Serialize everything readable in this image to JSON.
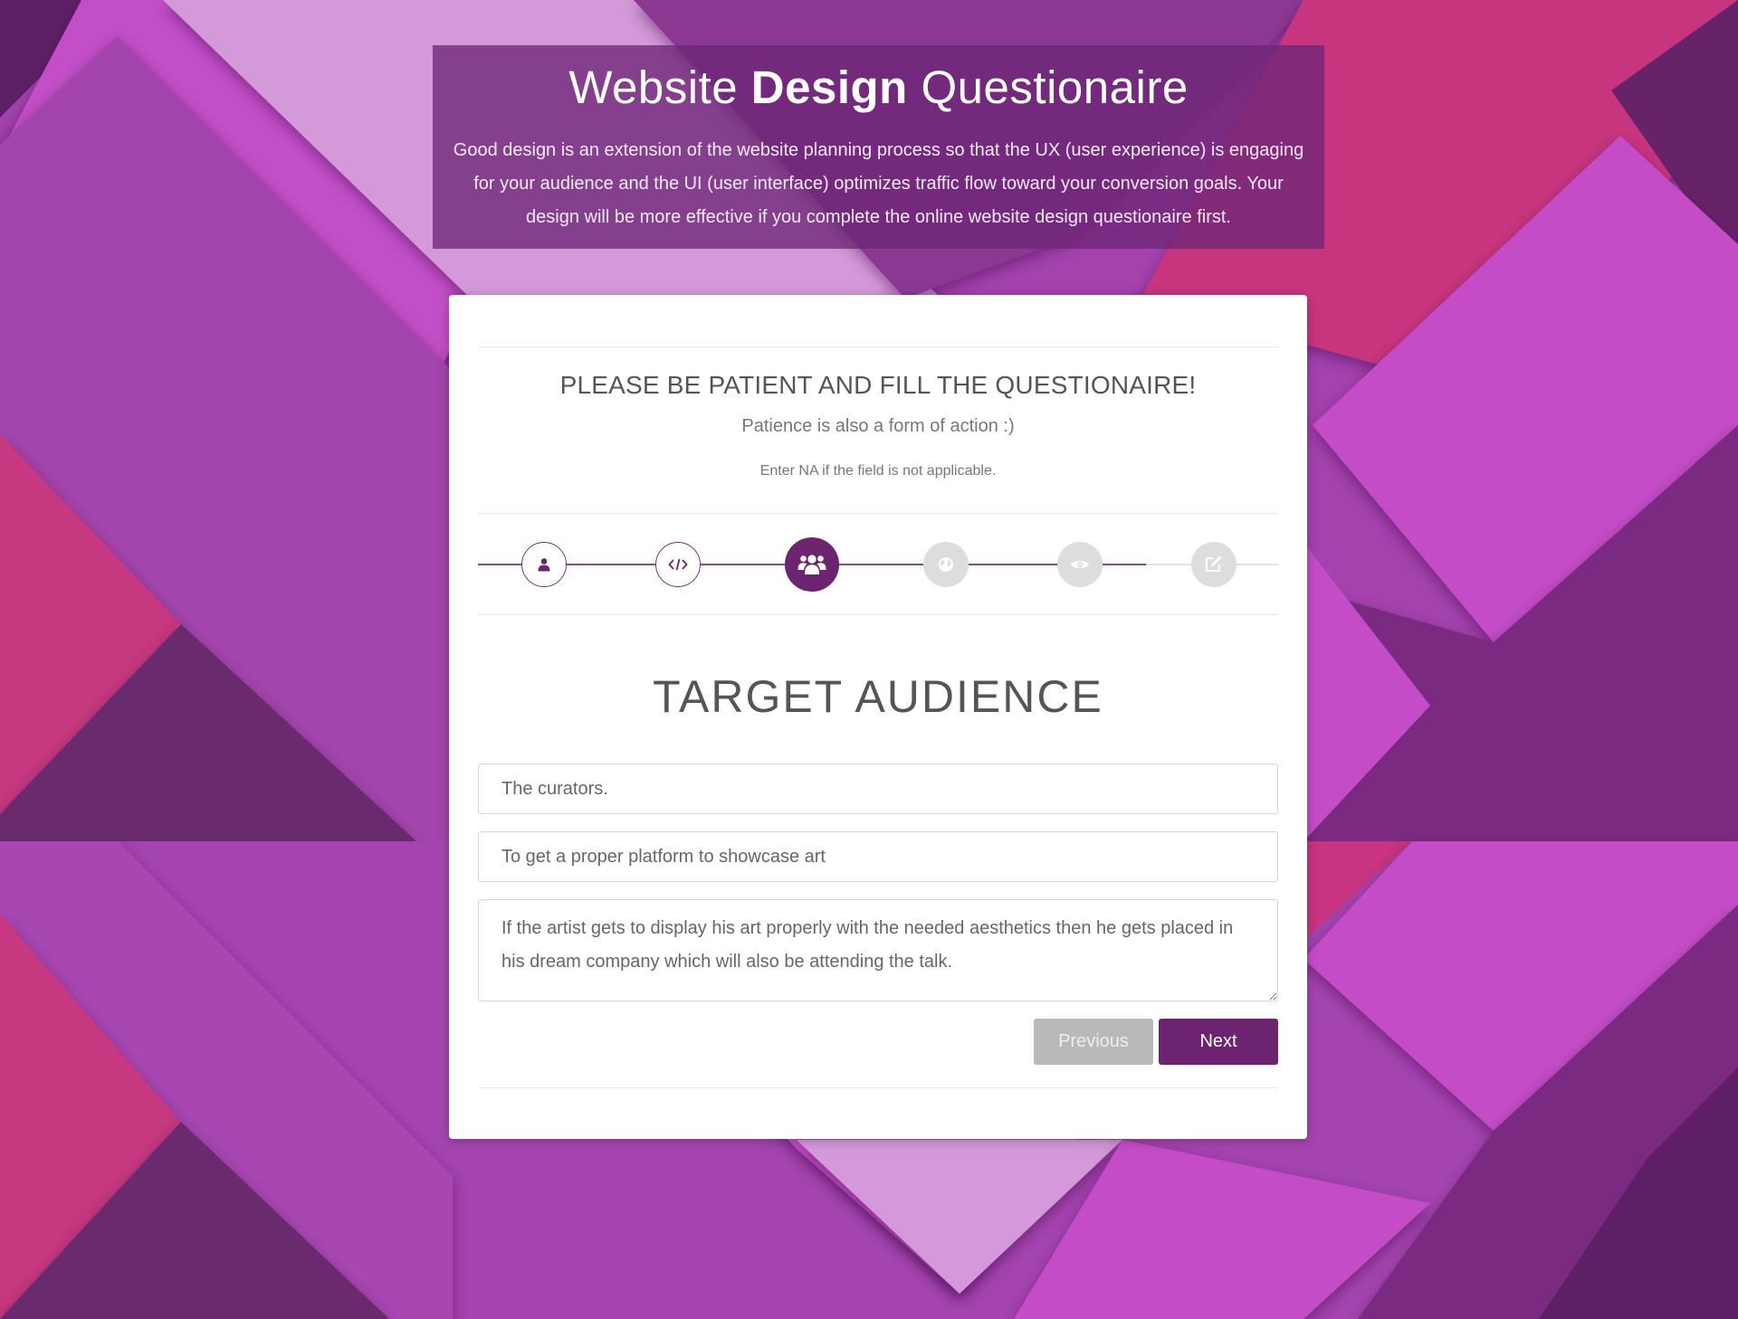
{
  "header": {
    "title_light_1": "Website",
    "title_bold": "Design",
    "title_light_2": "Questionaire",
    "description": "Good design is an extension of the website planning process so that the UX (user experience) is engaging for your audience and the UI (user interface) optimizes traffic flow toward your conversion goals. Your design will be more effective if you complete the online website design questionaire first."
  },
  "card": {
    "heading": "PLEASE BE PATIENT AND FILL THE QUESTIONAIRE!",
    "subtitle": "Patience is also a form of action :)",
    "note": "Enter NA if the field is not applicable.",
    "steps": [
      {
        "icon": "user-icon",
        "state": "done"
      },
      {
        "icon": "code-icon",
        "state": "done"
      },
      {
        "icon": "users-icon",
        "state": "active"
      },
      {
        "icon": "globe-icon",
        "state": "todo"
      },
      {
        "icon": "eye-icon",
        "state": "todo"
      },
      {
        "icon": "edit-icon",
        "state": "todo"
      }
    ],
    "section_title": "TARGET AUDIENCE",
    "fields": {
      "audience": "The curators.",
      "goal": "To get a proper platform to showcase art",
      "details": "If the artist gets to display his art properly with the needed aesthetics then he gets placed in his dream company which will also be attending the talk."
    },
    "buttons": {
      "previous": "Previous",
      "next": "Next"
    }
  },
  "colors": {
    "primary": "#6c2470",
    "inactive_step": "#dddddd",
    "previous_button": "#b9b9b9"
  }
}
